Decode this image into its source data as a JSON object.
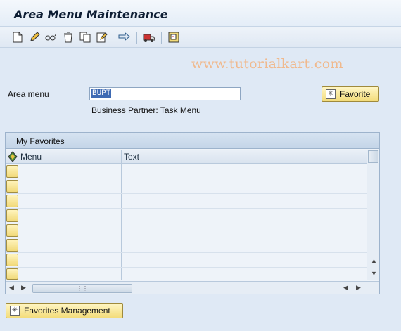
{
  "title": "Area Menu Maintenance",
  "watermark": "www.tutorialkart.com",
  "toolbar": {
    "icons": [
      "create-icon",
      "change-icon",
      "display-icon",
      "delete-icon",
      "copy-icon",
      "edit-icon",
      "transport-icon",
      "truck-icon",
      "where-used-icon"
    ]
  },
  "form": {
    "area_menu_label": "Area menu",
    "area_menu_value": "BUPT",
    "description": "Business Partner: Task Menu",
    "favorite_button": "Favorite"
  },
  "favorites": {
    "panel_title": "My Favorites",
    "columns": [
      "Menu",
      "Text"
    ],
    "rows": [
      {
        "menu": "",
        "text": ""
      },
      {
        "menu": "",
        "text": ""
      },
      {
        "menu": "",
        "text": ""
      },
      {
        "menu": "",
        "text": ""
      },
      {
        "menu": "",
        "text": ""
      },
      {
        "menu": "",
        "text": ""
      },
      {
        "menu": "",
        "text": ""
      },
      {
        "menu": "",
        "text": ""
      }
    ]
  },
  "favorites_management_button": "Favorites Management",
  "colors": {
    "background": "#dfe9f5",
    "button": "#f3dc7a",
    "selection": "#3e6ab3"
  }
}
